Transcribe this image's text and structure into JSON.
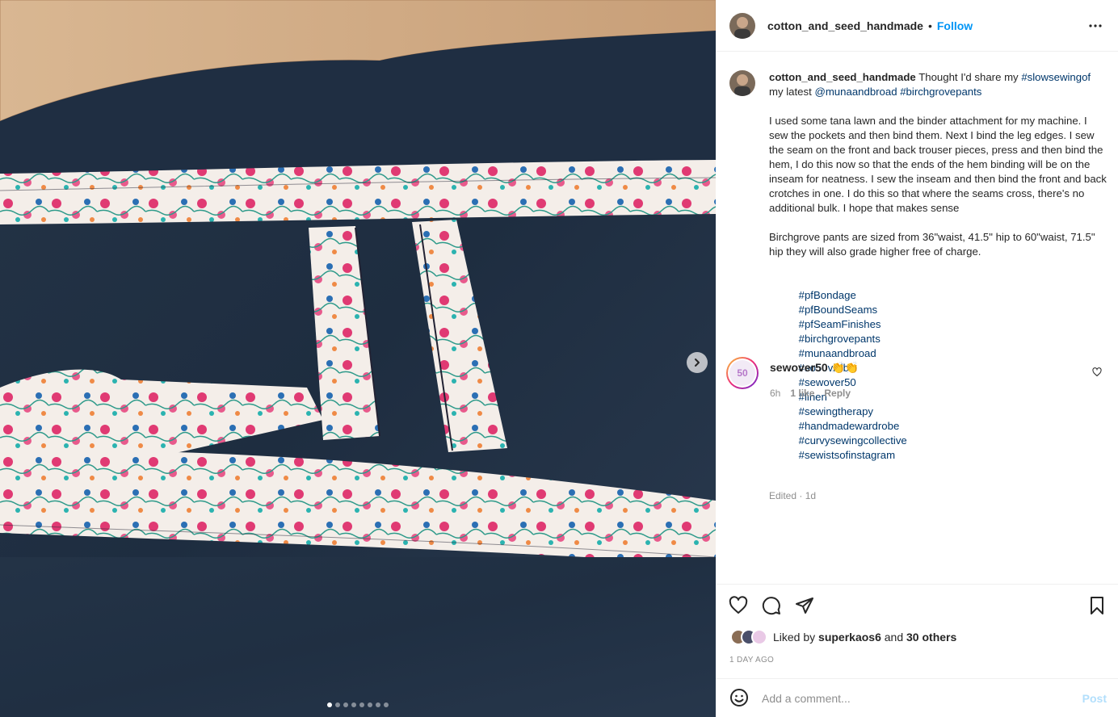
{
  "media": {
    "image_subject": "photo",
    "carousel_total": 8,
    "carousel_active": 1,
    "next_icon": "chevron-right-icon"
  },
  "post": {
    "username": "cotton_and_seed_handmade",
    "separator": "•",
    "follow_label": "Follow",
    "more_icon": "more-horizontal-icon"
  },
  "caption": {
    "username": "cotton_and_seed_handmade",
    "line1_text": "Thought I'd share my",
    "line1_tag": "#slowsewingof",
    "line2_text": "my latest",
    "line2_mention": "@munaandbroad",
    "line2_tag": "#birchgrovepants",
    "para1": "I used some tana lawn and the binder attachment for my machine. I sew the pockets and then bind them. Next I bind the leg edges. I sew the seam on the front and back trouser pieces, press and then bind the hem, I do this now so that the ends of the hem binding will be on the inseam for neatness. I sew the inseam and then bind the front and back crotches in one. I do this so that where the seams cross, there's no additional bulk. I hope that makes sense",
    "para2": "Birchgrove pants are sized from 36\"waist, 41.5\" hip to 60\"waist, 71.5\" hip they will also grade higher free of charge.",
    "hashtags": [
      "#pfBondage",
      "#pfBoundSeams",
      "#pfSeamFinishes",
      "#birchgrovepants",
      "#munaandbroad",
      "#so50visible",
      "#sewover50",
      "#linen",
      "#sewingtherapy",
      "#handmadewardrobe",
      "#curvysewingcollective",
      "#sewistsofinstagram"
    ],
    "meta": "Edited · 1d"
  },
  "comment": {
    "username": "sewover50",
    "emoji": "👏👏",
    "avatar_text": "50",
    "time": "6h",
    "likes": "1 like",
    "reply": "Reply"
  },
  "actions": {
    "liked_by_prefix": "Liked by",
    "liked_by_user": "superkaos6",
    "and": "and",
    "others": "30 others",
    "date": "1 DAY AGO",
    "comment_placeholder": "Add a comment...",
    "post_label": "Post"
  },
  "colors": {
    "accent": "#0095f6",
    "link": "#00376b",
    "muted": "#8e8e8e",
    "post_disabled": "#b2dffc"
  }
}
